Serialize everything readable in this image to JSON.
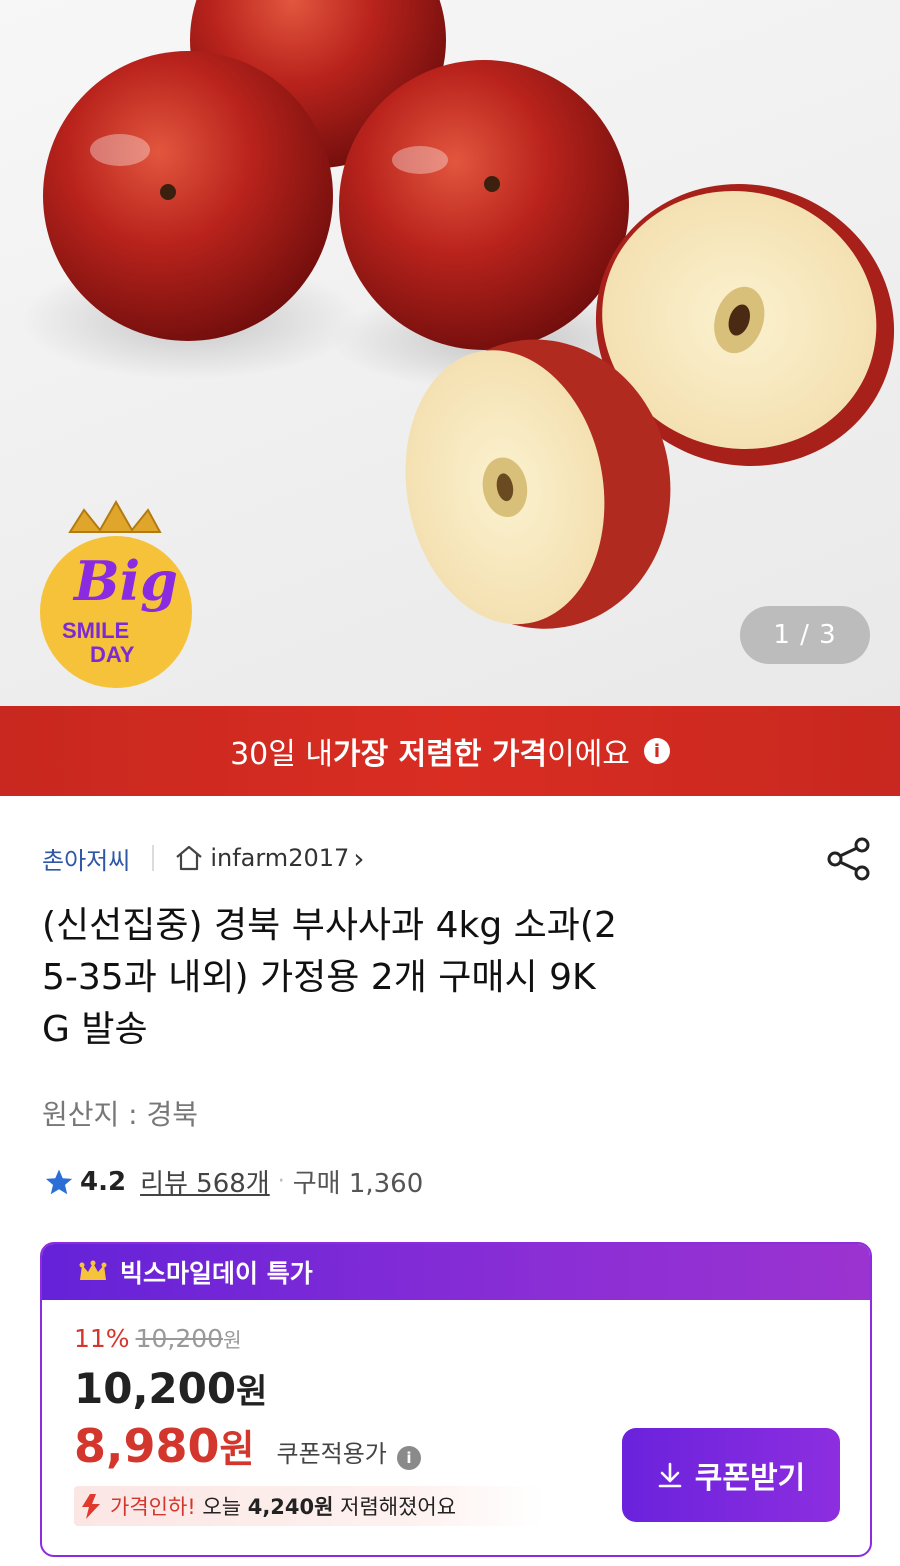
{
  "hero": {
    "counter": "1 / 3",
    "badge": {
      "script": "Big",
      "line1": "SMILE",
      "line2": "DAY"
    }
  },
  "banner": {
    "part1": "30일 내 ",
    "bold": "가장 저렴한 가격",
    "part2": "이에요",
    "info_icon": "info-icon"
  },
  "seller": {
    "brand": "촌아저씨",
    "shop": "infarm2017",
    "shop_chevron": "›"
  },
  "product": {
    "title": "(신선집중) 경북 부사사과 4kg 소과(2 5-35과 내외) 가정용 2개 구매시 9K G 발송",
    "title_lines": [
      "(신선집중) 경북 부사사과 4kg 소과(2",
      "5-35과 내외) 가정용 2개 구매시 9K",
      "G 발송"
    ],
    "origin": "원산지 : 경북",
    "rating": "4.2",
    "reviews": "리뷰 568개",
    "purchases": "구매 1,360"
  },
  "deal": {
    "header": "빅스마일데이 특가",
    "discount_pct": "11%",
    "original_price": "10,200",
    "original_unit": "원",
    "price_amount": "10,200",
    "price_unit": "원",
    "coupon_amount": "8,980",
    "coupon_unit": "원",
    "coupon_label": "쿠폰적용가",
    "drop_label": "가격인하!",
    "drop_today": " 오늘 ",
    "drop_amount": "4,240원",
    "drop_suffix": " 저렴해졌어요",
    "coupon_button": "쿠폰받기"
  },
  "colors": {
    "banner_red": "#d12a20",
    "deal_purple": "#7a28dc",
    "price_red": "#d3362c",
    "brand_blue": "#2e58a6"
  }
}
